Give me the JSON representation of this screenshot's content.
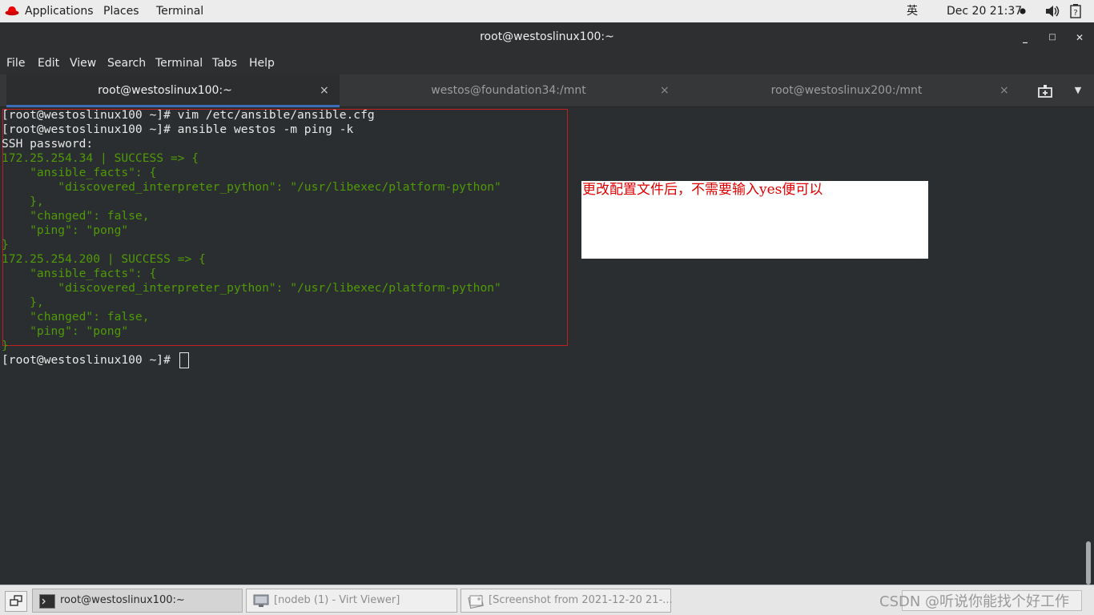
{
  "topbar": {
    "applications": "Applications",
    "places": "Places",
    "terminal": "Terminal",
    "input_method": "英",
    "datetime": "Dec 20  21:37"
  },
  "window": {
    "title": "root@westoslinux100:~",
    "controls": {
      "minimize": "_",
      "maximize": "□",
      "close": "✕"
    }
  },
  "menubar": [
    "File",
    "Edit",
    "View",
    "Search",
    "Terminal",
    "Tabs",
    "Help"
  ],
  "tabs": [
    {
      "label": "root@westoslinux100:~",
      "close": "×"
    },
    {
      "label": "westos@foundation34:/mnt",
      "close": "×"
    },
    {
      "label": "root@westoslinux200:/mnt",
      "close": "×"
    }
  ],
  "terminal": {
    "lines": [
      "[root@westoslinux100 ~]# vim /etc/ansible/ansible.cfg",
      "[root@westoslinux100 ~]# ansible westos -m ping -k",
      "SSH password:",
      "172.25.254.34 | SUCCESS => {",
      "    \"ansible_facts\": {",
      "        \"discovered_interpreter_python\": \"/usr/libexec/platform-python\"",
      "    },",
      "    \"changed\": false,",
      "    \"ping\": \"pong\"",
      "}",
      "172.25.254.200 | SUCCESS => {",
      "    \"ansible_facts\": {",
      "        \"discovered_interpreter_python\": \"/usr/libexec/platform-python\"",
      "    },",
      "    \"changed\": false,",
      "    \"ping\": \"pong\"",
      "}",
      "[root@westoslinux100 ~]# "
    ],
    "annotation": "更改配置文件后，不需要输入yes便可以"
  },
  "taskbar": {
    "tasks": [
      {
        "label": "root@westoslinux100:~"
      },
      {
        "label": "[nodeb (1) - Virt Viewer]"
      },
      {
        "label": "[Screenshot from 2021-12-20 21-..."
      }
    ],
    "watermark": "CSDN @听说你能找个好工作"
  },
  "colors": {
    "terminal_bg": "#2b2e30",
    "output_green": "#4f9a06",
    "annotation_red": "#e00000",
    "active_tab_underline": "#3d6db6"
  }
}
